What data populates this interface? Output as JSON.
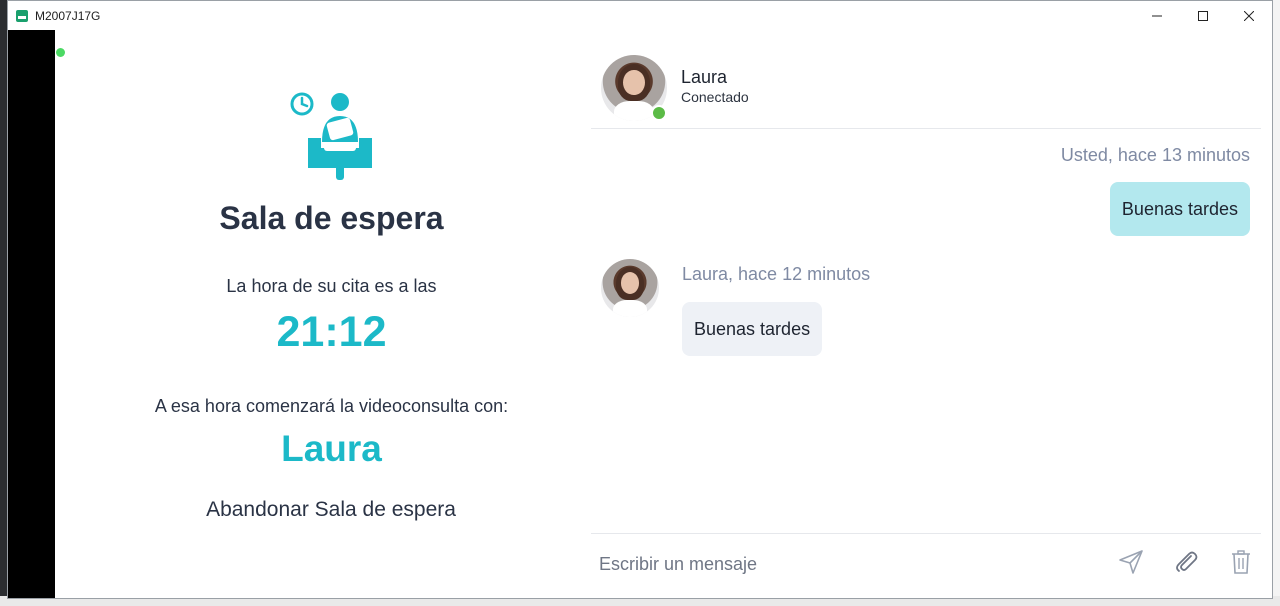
{
  "window": {
    "title": "M2007J17G"
  },
  "waiting_room": {
    "title": "Sala de espera",
    "appointment_label": "La hora de su cita es a las",
    "appointment_time": "21:12",
    "consult_label": "A esa hora comenzará la videoconsulta con:",
    "doctor_name": "Laura",
    "leave_label": "Abandonar Sala de espera",
    "icon": "waiting-room-icon",
    "accent_color": "#1cb9c8"
  },
  "chat": {
    "contact": {
      "name": "Laura",
      "status": "Conectado",
      "status_color": "#5bbb46"
    },
    "messages": [
      {
        "direction": "out",
        "meta": "Usted, hace 13 minutos",
        "text": "Buenas tardes"
      },
      {
        "direction": "in",
        "meta": "Laura, hace 12 minutos",
        "text": "Buenas tardes"
      }
    ],
    "composer": {
      "placeholder": "Escribir un mensaje",
      "icons": [
        "send-icon",
        "attach-icon",
        "trash-icon"
      ]
    }
  }
}
